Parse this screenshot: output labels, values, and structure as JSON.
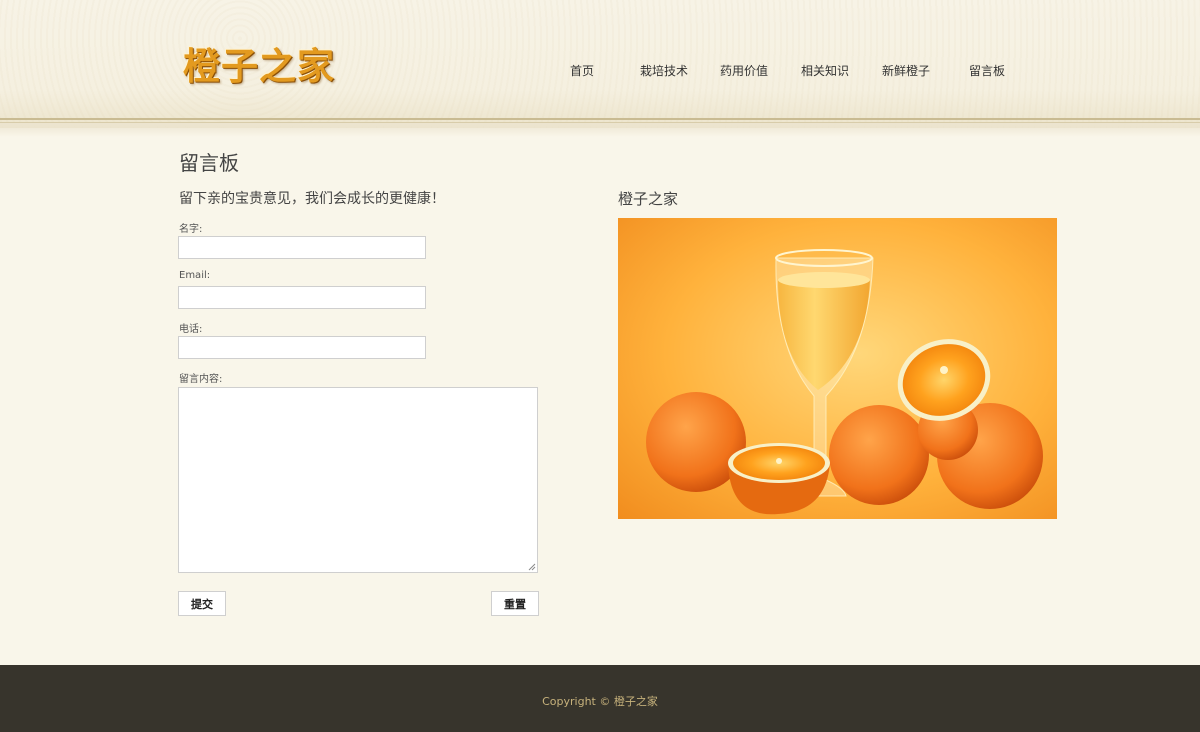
{
  "header": {
    "logo_text": "橙子之家",
    "nav": [
      {
        "label": "首页"
      },
      {
        "label": "栽培技术"
      },
      {
        "label": "药用价值"
      },
      {
        "label": "相关知识"
      },
      {
        "label": "新鲜橙子"
      },
      {
        "label": "留言板"
      }
    ]
  },
  "main": {
    "page_title": "留言板",
    "subtitle": "留下亲的宝贵意见，我们会成长的更健康！",
    "form": {
      "name_label": "名字:",
      "email_label": "Email:",
      "phone_label": "电话:",
      "message_label": "留言内容:",
      "name_value": "",
      "email_value": "",
      "phone_value": "",
      "message_value": "",
      "submit_label": "提交",
      "reset_label": "重置"
    },
    "side": {
      "title": "橙子之家"
    }
  },
  "footer": {
    "copyright": "Copyright © 橙子之家"
  },
  "colors": {
    "page_bg": "#f9f6ea",
    "footer_bg": "#37342c",
    "footer_text": "#c7b27c",
    "logo": "#e39a1f"
  }
}
